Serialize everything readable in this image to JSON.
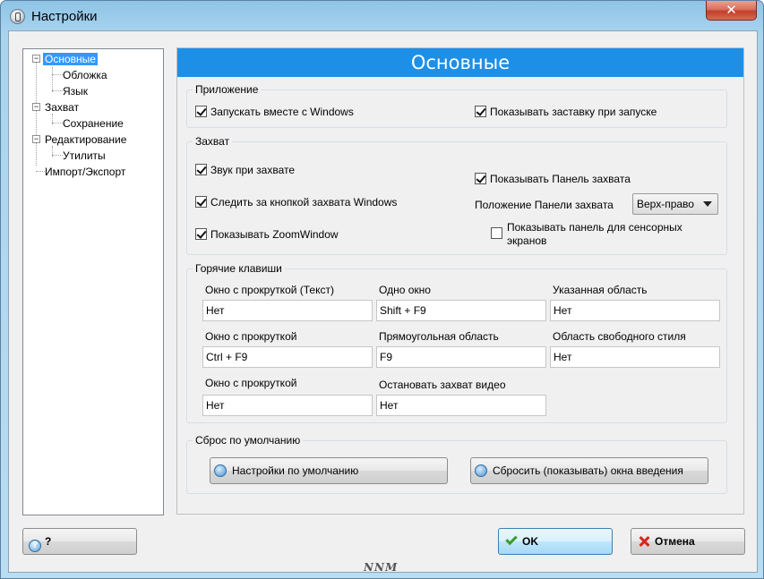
{
  "window": {
    "title": "Настройки",
    "close_glyph": "✕"
  },
  "tree": {
    "items": [
      {
        "label": "Основные",
        "selected": true
      },
      {
        "label": "Обложка"
      },
      {
        "label": "Язык"
      },
      {
        "label": "Захват"
      },
      {
        "label": "Сохранение"
      },
      {
        "label": "Редактирование"
      },
      {
        "label": "Утилиты"
      },
      {
        "label": "Импорт/Экспорт"
      }
    ],
    "expander_glyph": "−"
  },
  "panel": {
    "header": "Основные"
  },
  "app_group": {
    "label": "Приложение",
    "start_with_windows": {
      "label": "Запускать вместе с Windows",
      "checked": true
    },
    "show_splash": {
      "label": "Показывать заставку при запуске",
      "checked": true
    }
  },
  "capture_group": {
    "label": "Захват",
    "sound": {
      "label": "Звук при захвате",
      "checked": true
    },
    "track_button": {
      "label": "Следить за кнопкой захвата Windows",
      "checked": true
    },
    "zoom_window": {
      "label": "Показывать ZoomWindow",
      "checked": true
    },
    "show_panel": {
      "label": "Показывать Панель захвата",
      "checked": true
    },
    "panel_position_label": "Положение Панели захвата",
    "panel_position_value": "Верх-право",
    "touch_panel": {
      "label": "Показывать панель для сенсорных экранов",
      "checked": false
    }
  },
  "hotkeys_group": {
    "label": "Горячие клавиши",
    "fields": [
      {
        "label": "Окно с прокруткой (Текст)",
        "value": "Нет"
      },
      {
        "label": "Одно окно",
        "value": "Shift + F9"
      },
      {
        "label": "Указанная область",
        "value": "Нет"
      },
      {
        "label": "Окно с прокруткой",
        "value": "Ctrl + F9"
      },
      {
        "label": "Прямоугольная область",
        "value": "F9"
      },
      {
        "label": "Область свободного стиля",
        "value": "Нет"
      },
      {
        "label": "Окно с прокруткой",
        "value": "Нет"
      },
      {
        "label": "Остановать захват видео",
        "value": "Нет"
      }
    ]
  },
  "reset_group": {
    "label": "Сброс по умолчанию",
    "defaults_button": "Настройки по умолчанию",
    "reset_intro_button": "Сбросить (показывать) окна введения"
  },
  "footer": {
    "help_button": "?",
    "help_icon_glyph": "?",
    "ok_button": "OK",
    "cancel_button": "Отмена"
  },
  "watermark": "NNM"
}
